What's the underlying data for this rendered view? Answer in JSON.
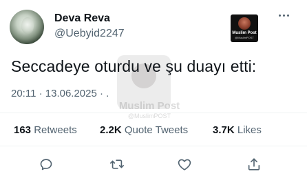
{
  "author": {
    "display_name": "Deva Reva",
    "handle": "@Uebyid2247"
  },
  "media_badge": {
    "title": "Muslim Post",
    "subtitle": "@MuslimPOST"
  },
  "watermark": {
    "title": "Muslim Post",
    "subtitle": "@MuslimPOST"
  },
  "tweet": {
    "text": "Seccadeye oturdu ve şu duayı etti:",
    "timestamp": "20:11 · 13.06.2025 · ."
  },
  "stats": {
    "retweets": {
      "count": "163",
      "label": "Retweets"
    },
    "quotes": {
      "count": "2.2K",
      "label": "Quote Tweets"
    },
    "likes": {
      "count": "3.7K",
      "label": "Likes"
    }
  },
  "icons": {
    "more": "more-horizontal-icon",
    "reply": "reply-icon",
    "retweet": "retweet-icon",
    "like": "heart-icon",
    "share": "share-icon"
  },
  "colors": {
    "text_primary": "#0f1419",
    "text_secondary": "#536471",
    "divider": "#eff3f4",
    "background": "#ffffff"
  }
}
